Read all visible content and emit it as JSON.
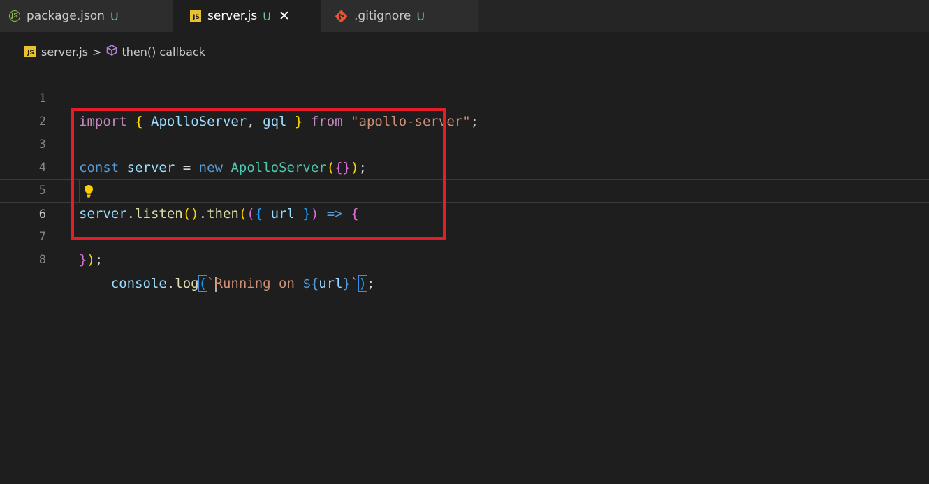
{
  "tabs": [
    {
      "label": "package.json",
      "status": "U",
      "icon": "npm-icon",
      "active": false
    },
    {
      "label": "server.js",
      "status": "U",
      "icon": "js-file-icon",
      "active": true,
      "close": "✕"
    },
    {
      "label": ".gitignore",
      "status": "U",
      "icon": "git-icon",
      "active": false
    }
  ],
  "breadcrumb": {
    "file": "server.js",
    "separator": ">",
    "symbol": "then() callback"
  },
  "icons": {
    "js_badge": "JS",
    "npm_badge": "JS"
  },
  "code": {
    "line_numbers": [
      "1",
      "2",
      "3",
      "4",
      "5",
      "6",
      "7",
      "8"
    ],
    "lines": [
      "import { ApolloServer, gql } from \"apollo-server\";",
      "",
      "const server = new ApolloServer({});",
      "",
      "server.listen().then(({ url }) => {",
      "  console.log(`Running on ${url}`);",
      "});",
      ""
    ],
    "current_line": 6
  },
  "colors": {
    "highlight_box": "#e41e26",
    "editor_background": "#1e1e1e",
    "untracked_status": "#73c991"
  }
}
